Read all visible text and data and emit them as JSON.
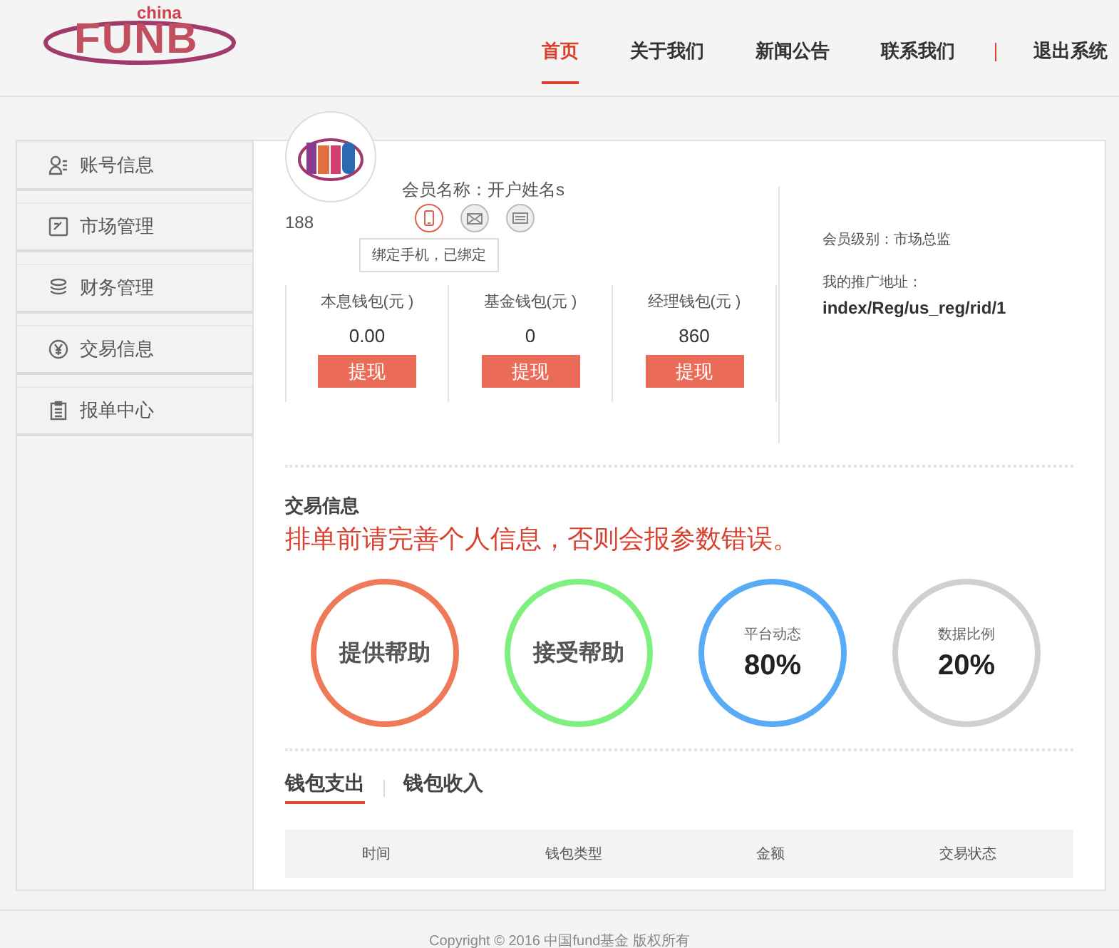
{
  "logo": {
    "small": "china",
    "big": "FUNB"
  },
  "nav": [
    {
      "label": "首页",
      "selected": true
    },
    {
      "label": "关于我们",
      "selected": false
    },
    {
      "label": "新闻公告",
      "selected": false
    },
    {
      "label": "联系我们",
      "selected": false
    },
    {
      "label": "退出系统",
      "selected": false
    }
  ],
  "sidebar": {
    "items": [
      {
        "label": "账号信息",
        "kind": "user"
      },
      {
        "label": "市场管理",
        "kind": "edit"
      },
      {
        "label": "财务管理",
        "kind": "coins"
      },
      {
        "label": "交易信息",
        "kind": "yen"
      },
      {
        "label": "报单中心",
        "kind": "clipboard"
      }
    ]
  },
  "profile": {
    "member_name": "会员名称：开户姓名s",
    "id": "188",
    "bindings": [
      {
        "kind": "phone",
        "selected": true
      },
      {
        "kind": "mail",
        "selected": false
      },
      {
        "kind": "card",
        "selected": false
      }
    ],
    "tooltip": "绑定手机，已绑定",
    "wallets": [
      {
        "label": "本息钱包(元 )",
        "amount": "0.00",
        "button": "提现"
      },
      {
        "label": "基金钱包(元 )",
        "amount": "0",
        "button": "提现"
      },
      {
        "label": "经理钱包(元 )",
        "amount": "860",
        "button": "提现"
      }
    ],
    "level": "会员级别：市场总监",
    "promo_label": "我的推广地址：",
    "promo_url": "index/Reg/us_reg/rid/1"
  },
  "trade": {
    "title": "交易信息",
    "warning": "排单前请完善个人信息，否则会报参数错误。",
    "circles": [
      {
        "kind": "action",
        "label": "提供帮助",
        "color": "#ef7a5a"
      },
      {
        "kind": "action",
        "label": "接受帮助",
        "color": "#7fef7f"
      },
      {
        "kind": "stat",
        "label": "平台动态",
        "value": "80%",
        "color": "#5aabf5"
      },
      {
        "kind": "stat",
        "label": "数据比例",
        "value": "20%",
        "color": "#d0d0d0"
      }
    ]
  },
  "wallet_tabs": [
    {
      "label": "钱包支出",
      "selected": true
    },
    {
      "label": "钱包收入",
      "selected": false
    }
  ],
  "table": {
    "columns": [
      "时间",
      "钱包类型",
      "金额",
      "交易状态"
    ]
  },
  "footer": "Copyright © 2016 中国fund基金 版权所有"
}
